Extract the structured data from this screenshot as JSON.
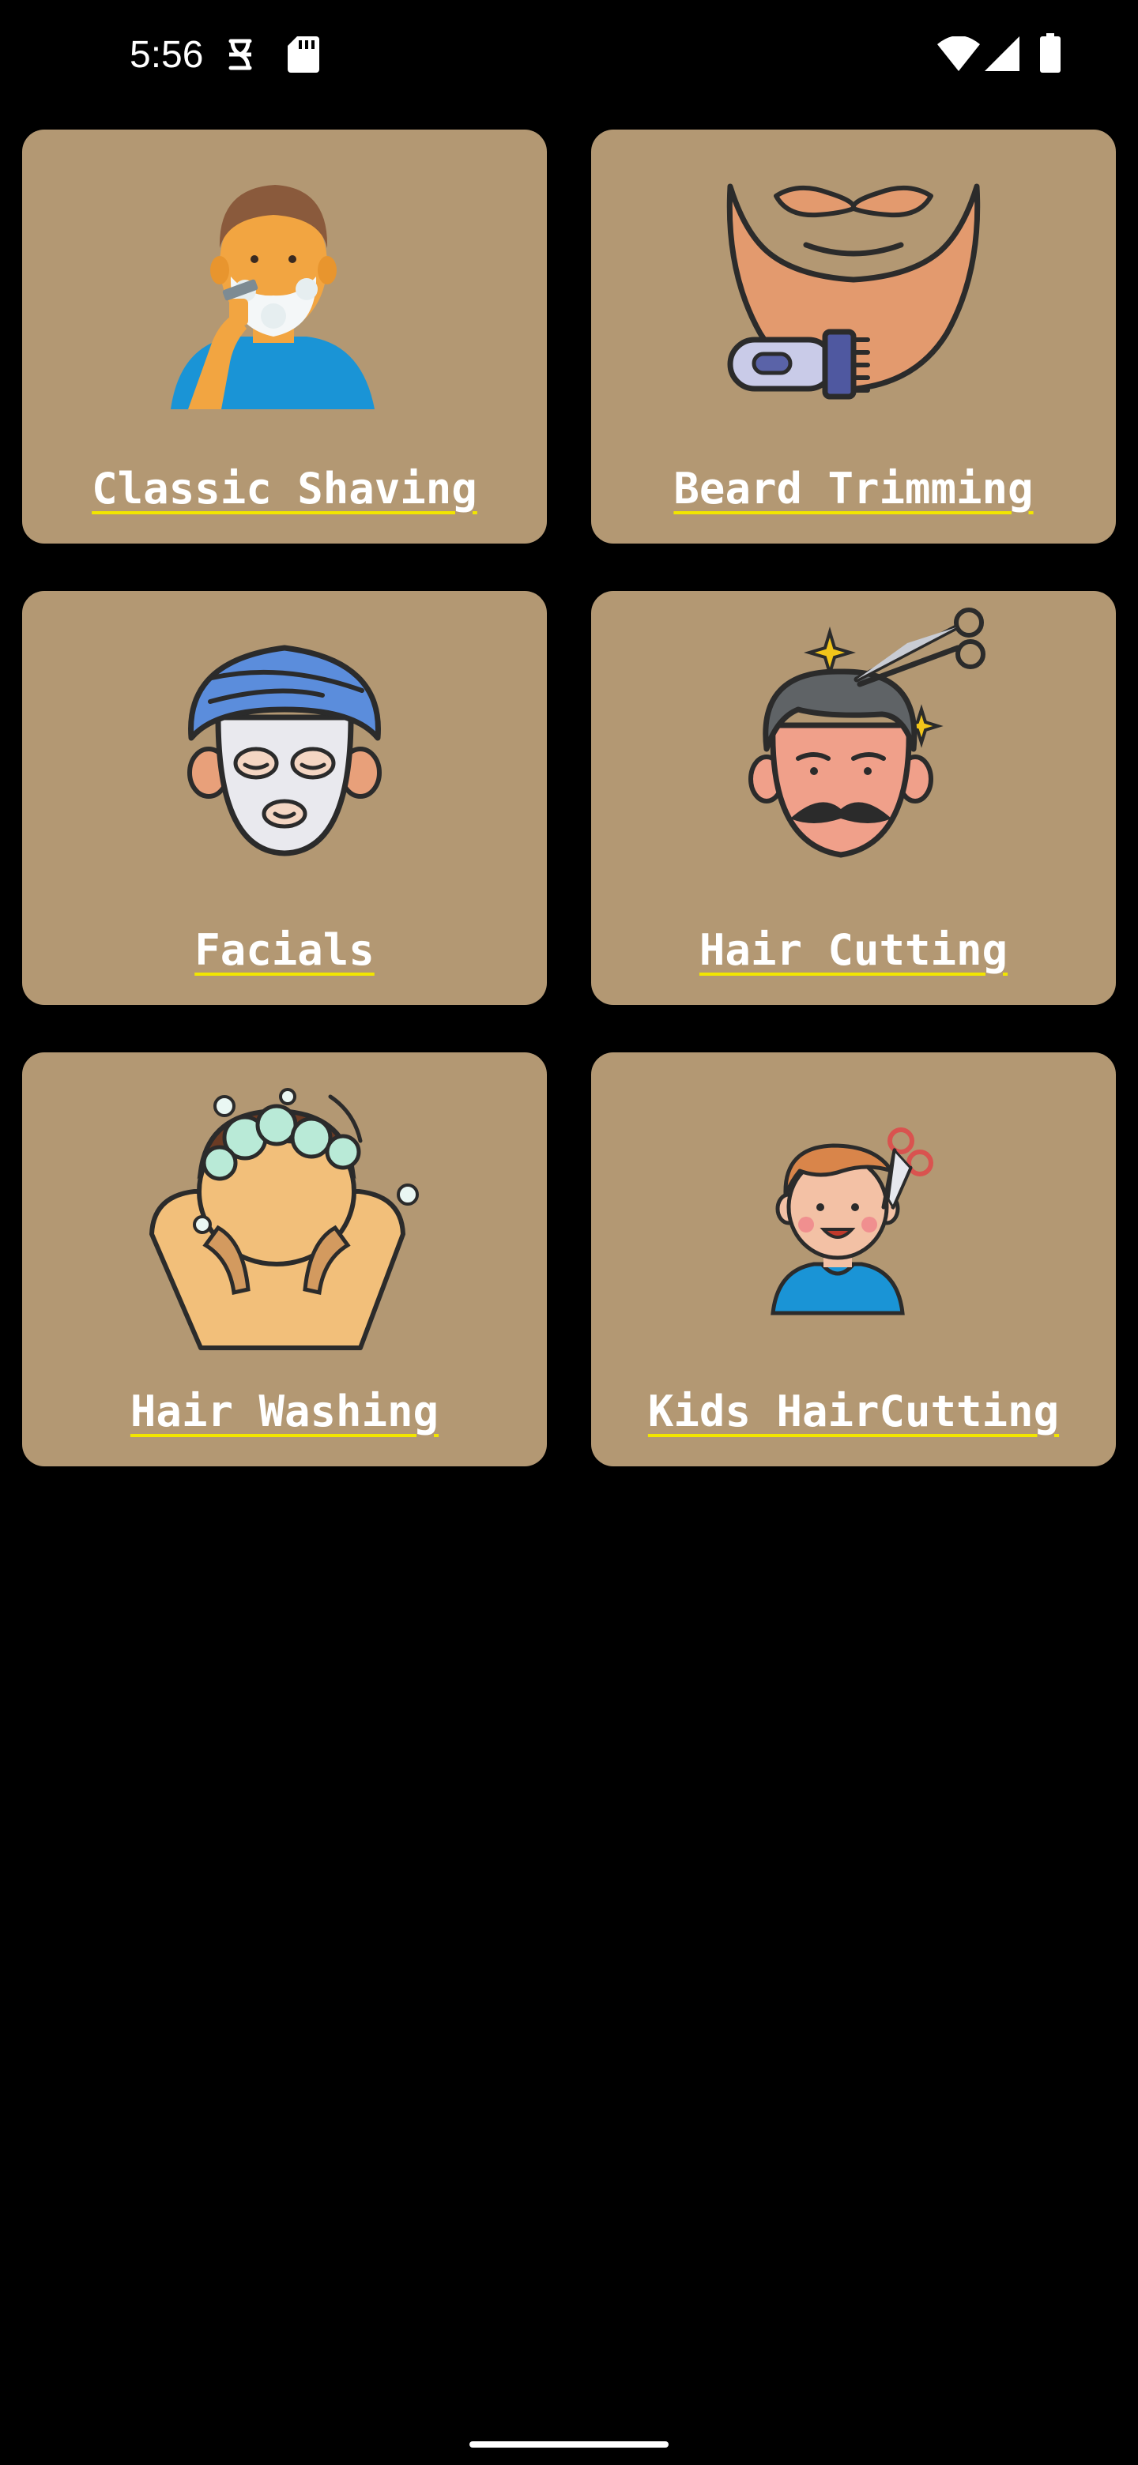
{
  "status_bar": {
    "time": "5:56",
    "notification_icons": [
      "sync-icon",
      "sd-card-icon"
    ],
    "system_icons": [
      "wifi-icon",
      "cellular-signal-icon",
      "battery-icon"
    ]
  },
  "theme": {
    "background": "#000000",
    "card_color": "#B39873",
    "label_color": "#FFFFFF",
    "underline_color": "#F2E600"
  },
  "services": [
    {
      "label": "Classic Shaving",
      "icon": "man-shaving-icon"
    },
    {
      "label": "Beard Trimming",
      "icon": "beard-trimmer-icon"
    },
    {
      "label": "Facials",
      "icon": "face-mask-icon"
    },
    {
      "label": "Hair Cutting",
      "icon": "man-haircut-scissors-icon"
    },
    {
      "label": "Hair Washing",
      "icon": "hair-washing-icon"
    },
    {
      "label": "Kids HairCutting",
      "icon": "kid-haircut-icon"
    }
  ]
}
